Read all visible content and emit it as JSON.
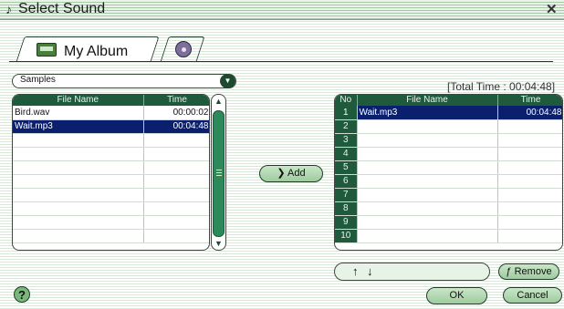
{
  "window": {
    "title": "Select Sound",
    "title_icon": "♪",
    "close": "✕"
  },
  "tabs": [
    {
      "label": "My Album",
      "icon": "album-icon"
    },
    {
      "label": "",
      "icon": "disc-icon"
    }
  ],
  "source": {
    "selected": "Samples"
  },
  "total_time": "[Total Time : 00:04:48]",
  "left_table": {
    "headers": [
      "File Name",
      "Time"
    ],
    "rows": [
      [
        "Bird.wav",
        "00:00:02"
      ],
      [
        "Wait.mp3",
        "00:04:48"
      ],
      [
        "",
        ""
      ],
      [
        "",
        ""
      ],
      [
        "",
        ""
      ],
      [
        "",
        ""
      ],
      [
        "",
        ""
      ],
      [
        "",
        ""
      ],
      [
        "",
        ""
      ],
      [
        "",
        ""
      ]
    ]
  },
  "right_table": {
    "headers": [
      "No",
      "File Name",
      "Time"
    ],
    "rows": [
      [
        "1",
        "Wait.mp3",
        "00:04:48"
      ],
      [
        "2",
        "",
        ""
      ],
      [
        "3",
        "",
        ""
      ],
      [
        "4",
        "",
        ""
      ],
      [
        "5",
        "",
        ""
      ],
      [
        "6",
        "",
        ""
      ],
      [
        "7",
        "",
        ""
      ],
      [
        "8",
        "",
        ""
      ],
      [
        "9",
        "",
        ""
      ],
      [
        "10",
        "",
        ""
      ]
    ]
  },
  "buttons": {
    "add": "Add",
    "remove": "Remove",
    "ok": "OK",
    "cancel": "Cancel",
    "help": "?"
  },
  "arrows": {
    "up": "↑",
    "down": "↓"
  },
  "colors": {
    "header": "#1f5a3c",
    "selected_row": "#0a1f6e"
  }
}
